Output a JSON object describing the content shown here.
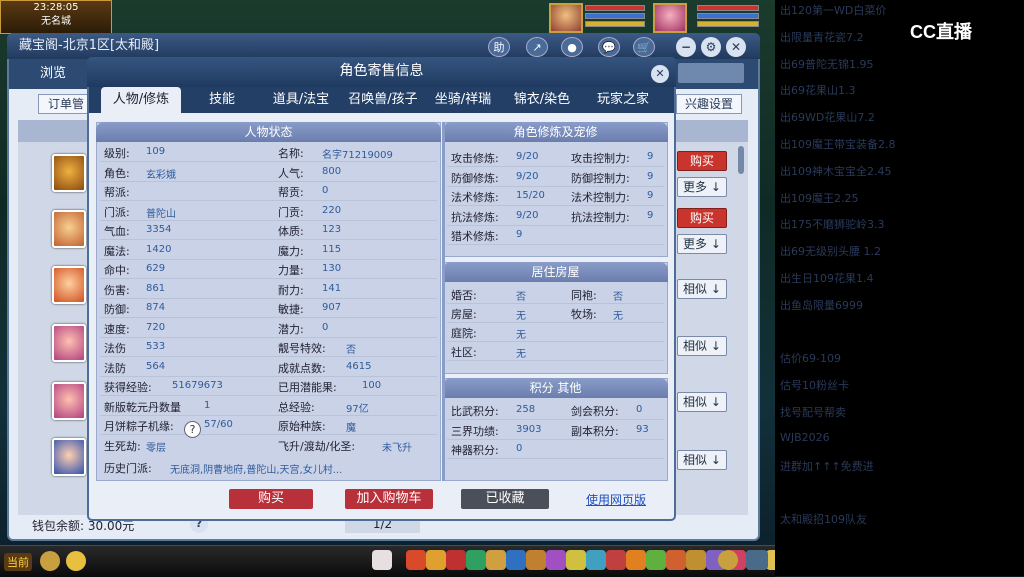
{
  "hud": {
    "time": "23:28:05",
    "city": "无名城"
  },
  "main_window": {
    "title": "藏宝阁-北京1区[太和殿]",
    "icons": [
      "助",
      "↗",
      "●",
      "💬",
      "🛒"
    ],
    "tab_browse": "浏览",
    "tab_orders": "订单管",
    "interest_settings": "兴趣设置",
    "right_buttons": [
      "购买",
      "更多",
      "购买",
      "更多",
      "相似",
      "相似",
      "相似",
      "相似"
    ],
    "wallet_label": "钱包余额:",
    "wallet_value": "30.00元",
    "help": "?",
    "pager": "1/2"
  },
  "modal": {
    "title": "角色寄售信息",
    "tabs": [
      "人物/修炼",
      "技能",
      "道具/法宝",
      "召唤兽/孩子",
      "坐骑/祥瑞",
      "锦衣/染色",
      "玩家之家"
    ],
    "left_section": "人物状态",
    "left_rows": [
      {
        "k1": "级别:",
        "v1": "109",
        "k2": "名称:",
        "v2": "名字71219009"
      },
      {
        "k1": "角色:",
        "v1": "玄彩娥",
        "k2": "人气:",
        "v2": "800"
      },
      {
        "k1": "帮派:",
        "v1": "",
        "k2": "帮贡:",
        "v2": "0"
      },
      {
        "k1": "门派:",
        "v1": "普陀山",
        "k2": "门贡:",
        "v2": "220"
      },
      {
        "k1": "气血:",
        "v1": "3354",
        "k2": "体质:",
        "v2": "123"
      },
      {
        "k1": "魔法:",
        "v1": "1420",
        "k2": "魔力:",
        "v2": "115"
      },
      {
        "k1": "命中:",
        "v1": "629",
        "k2": "力量:",
        "v2": "130"
      },
      {
        "k1": "伤害:",
        "v1": "861",
        "k2": "耐力:",
        "v2": "141"
      },
      {
        "k1": "防御:",
        "v1": "874",
        "k2": "敏捷:",
        "v2": "907"
      },
      {
        "k1": "速度:",
        "v1": "720",
        "k2": "潜力:",
        "v2": "0"
      },
      {
        "k1": "法伤",
        "v1": "533",
        "k2": "靓号特效:",
        "v2": "否"
      },
      {
        "k1": "法防",
        "v1": "564",
        "k2": "成就点数:",
        "v2": "4615"
      },
      {
        "k1": "获得经验:",
        "v1": "51679673",
        "k2": "已用潜能果:",
        "v2": "100"
      },
      {
        "k1": "新版乾元丹数量",
        "v1": "1",
        "k2": "总经验:",
        "v2": "97亿"
      },
      {
        "k1": "月饼粽子机缘:",
        "v1": "57/60",
        "k2": "原始种族:",
        "v2": "魔"
      },
      {
        "k1": "生死劫:",
        "v1": "零层",
        "k2": "飞升/渡劫/化圣:",
        "v2": "未飞升"
      }
    ],
    "history_label": "历史门派:",
    "history_value": "无底洞,阴曹地府,普陀山,天宫,女儿村...",
    "cult_section": "角色修炼及宠修",
    "cult_rows": [
      {
        "k1": "攻击修炼:",
        "v1": "9/20",
        "k2": "攻击控制力:",
        "v2": "9"
      },
      {
        "k1": "防御修炼:",
        "v1": "9/20",
        "k2": "防御控制力:",
        "v2": "9"
      },
      {
        "k1": "法术修炼:",
        "v1": "15/20",
        "k2": "法术控制力:",
        "v2": "9"
      },
      {
        "k1": "抗法修炼:",
        "v1": "9/20",
        "k2": "抗法控制力:",
        "v2": "9"
      },
      {
        "k1": "猎术修炼:",
        "v1": "9",
        "k2": "",
        "v2": ""
      }
    ],
    "house_section": "居住房屋",
    "house_rows": [
      {
        "k1": "婚否:",
        "v1": "否",
        "k2": "同袍:",
        "v2": "否"
      },
      {
        "k1": "房屋:",
        "v1": "无",
        "k2": "牧场:",
        "v2": "无"
      },
      {
        "k1": "庭院:",
        "v1": "无",
        "k2": "",
        "v2": ""
      },
      {
        "k1": "社区:",
        "v1": "无",
        "k2": "",
        "v2": ""
      }
    ],
    "score_section": "积分 其他",
    "score_rows": [
      {
        "k1": "比武积分:",
        "v1": "258",
        "k2": "剑会积分:",
        "v2": "0"
      },
      {
        "k1": "三界功绩:",
        "v1": "3903",
        "k2": "副本积分:",
        "v2": "93"
      },
      {
        "k1": "神器积分:",
        "v1": "0",
        "k2": "",
        "v2": ""
      }
    ],
    "btn_buy": "购买",
    "btn_cart": "加入购物车",
    "btn_fav": "已收藏",
    "link_web": "使用网页版"
  },
  "right_panel": {
    "logo": "CC直播",
    "lines": [
      "出120第一WD白菜价",
      "出限量青花瓷7.2",
      "出69普陀无锦1.95",
      "出69花果山1.3",
      "出69WD花果山7.2",
      "出109魔王带宝装备2.8",
      "出109神木宝宝全2.45",
      "出109魔王2.25",
      "出175不磨狮驼岭3.3",
      "出69无级别头腰 1.2",
      "出生日109花果1.4",
      "出鱼岛限量6999",
      "",
      "估价69-109",
      "估号10粉丝卡",
      "找号配号帮卖",
      "   WJB2026",
      "进群加↑↑↑免费进",
      "",
      "太和殿招109队友"
    ]
  },
  "bottom_bar": {
    "label": "当前"
  }
}
